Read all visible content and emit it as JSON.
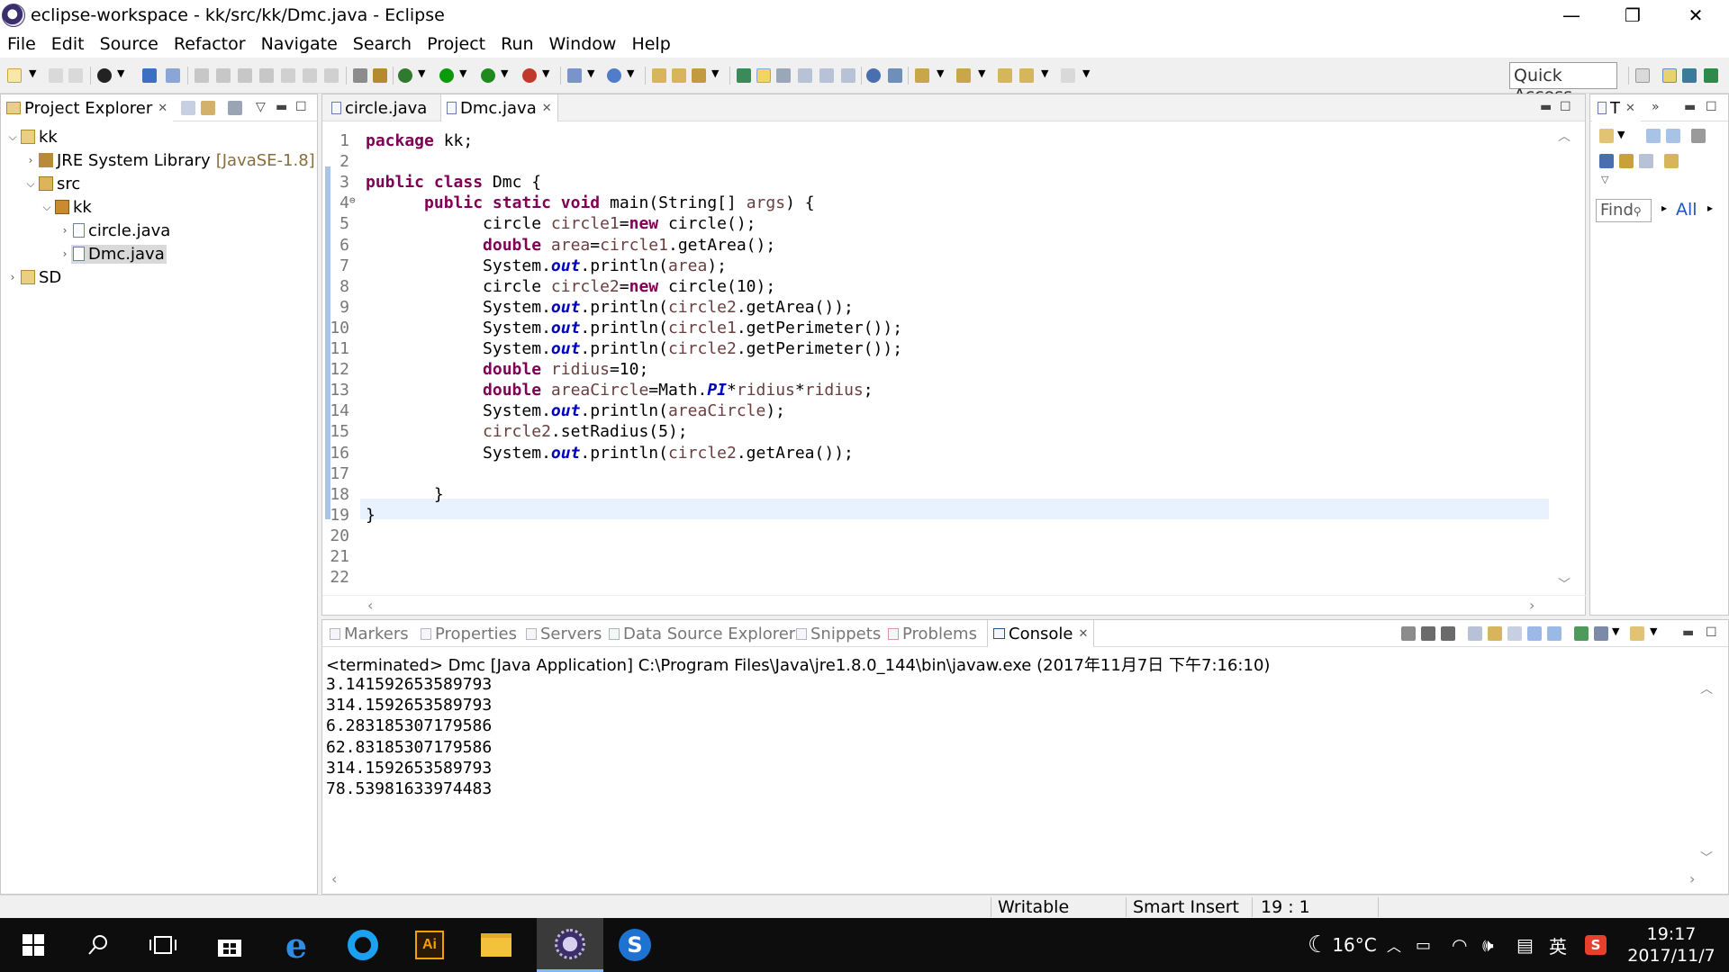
{
  "window": {
    "title": "eclipse-workspace - kk/src/kk/Dmc.java - Eclipse",
    "minimize": "—",
    "restore": "❐",
    "close": "✕"
  },
  "menu": [
    "File",
    "Edit",
    "Source",
    "Refactor",
    "Navigate",
    "Search",
    "Project",
    "Run",
    "Window",
    "Help"
  ],
  "toolbar": {
    "quick_access": "Quick Access"
  },
  "project_explorer": {
    "tab_label": "Project Explorer",
    "tree": [
      {
        "label": "kk",
        "depth": 0,
        "expanded": true,
        "icon": "project-icon"
      },
      {
        "label": "JRE System Library",
        "suffix": "[JavaSE-1.8]",
        "depth": 1,
        "expanded": false,
        "icon": "library-icon"
      },
      {
        "label": "src",
        "depth": 1,
        "expanded": true,
        "icon": "source-folder-icon"
      },
      {
        "label": "kk",
        "depth": 2,
        "expanded": true,
        "icon": "package-icon"
      },
      {
        "label": "circle.java",
        "depth": 3,
        "expanded": false,
        "icon": "java-file-icon"
      },
      {
        "label": "Dmc.java",
        "depth": 3,
        "expanded": false,
        "icon": "java-file-icon",
        "selected": true
      },
      {
        "label": "SD",
        "depth": 0,
        "expanded": false,
        "icon": "project-icon"
      }
    ]
  },
  "editor": {
    "tabs": [
      {
        "label": "circle.java",
        "active": false
      },
      {
        "label": "Dmc.java",
        "active": true
      }
    ],
    "line_numbers": [
      "1",
      "2",
      "3",
      "4",
      "5",
      "6",
      "7",
      "8",
      "9",
      "10",
      "11",
      "12",
      "13",
      "14",
      "15",
      "16",
      "17",
      "18",
      "19",
      "20",
      "21",
      "22"
    ],
    "current_line": 19,
    "code": [
      "package kk;",
      "",
      "public class Dmc {",
      "\tpublic static void main(String[] args) {",
      "\t\tcircle circle1=new circle();",
      "\t\tdouble area=circle1.getArea();",
      "\t\tSystem.out.println(area);",
      "\t\tcircle circle2=new circle(10);",
      "\t\tSystem.out.println(circle2.getArea());",
      "\t\tSystem.out.println(circle1.getPerimeter());",
      "\t\tSystem.out.println(circle2.getPerimeter());",
      "\t\tdouble ridius=10;",
      "\t\tdouble areaCircle=Math.PI*ridius*ridius;",
      "\t\tSystem.out.println(areaCircle);",
      "\t\tcircle2.setRadius(5);",
      "\t\tSystem.out.println(circle2.getArea());",
      "",
      "\t }",
      "}",
      "",
      "",
      ""
    ]
  },
  "outline": {
    "tab_label": "T",
    "find_placeholder": "Find",
    "all_label": "All"
  },
  "bottom_panel": {
    "tabs": [
      "Markers",
      "Properties",
      "Servers",
      "Data Source Explorer",
      "Snippets",
      "Problems",
      "Console"
    ],
    "active_tab": "Console",
    "header": "<terminated> Dmc [Java Application] C:\\Program Files\\Java\\jre1.8.0_144\\bin\\javaw.exe (2017年11月7日 下午7:16:10)",
    "output": [
      "3.141592653589793",
      "314.1592653589793",
      "6.283185307179586",
      "62.83185307179586",
      "314.1592653589793",
      "78.53981633974483"
    ]
  },
  "status": {
    "writable": "Writable",
    "insert_mode": "Smart Insert",
    "position": "19 : 1"
  },
  "taskbar": {
    "weather": "16°C",
    "ime": "英",
    "time": "19:17",
    "date": "2017/11/7"
  },
  "colors": {
    "keyword": "#7f0055",
    "local_var": "#6a3e3e",
    "static_field": "#0000c0",
    "current_line": "#e8f2fe"
  }
}
